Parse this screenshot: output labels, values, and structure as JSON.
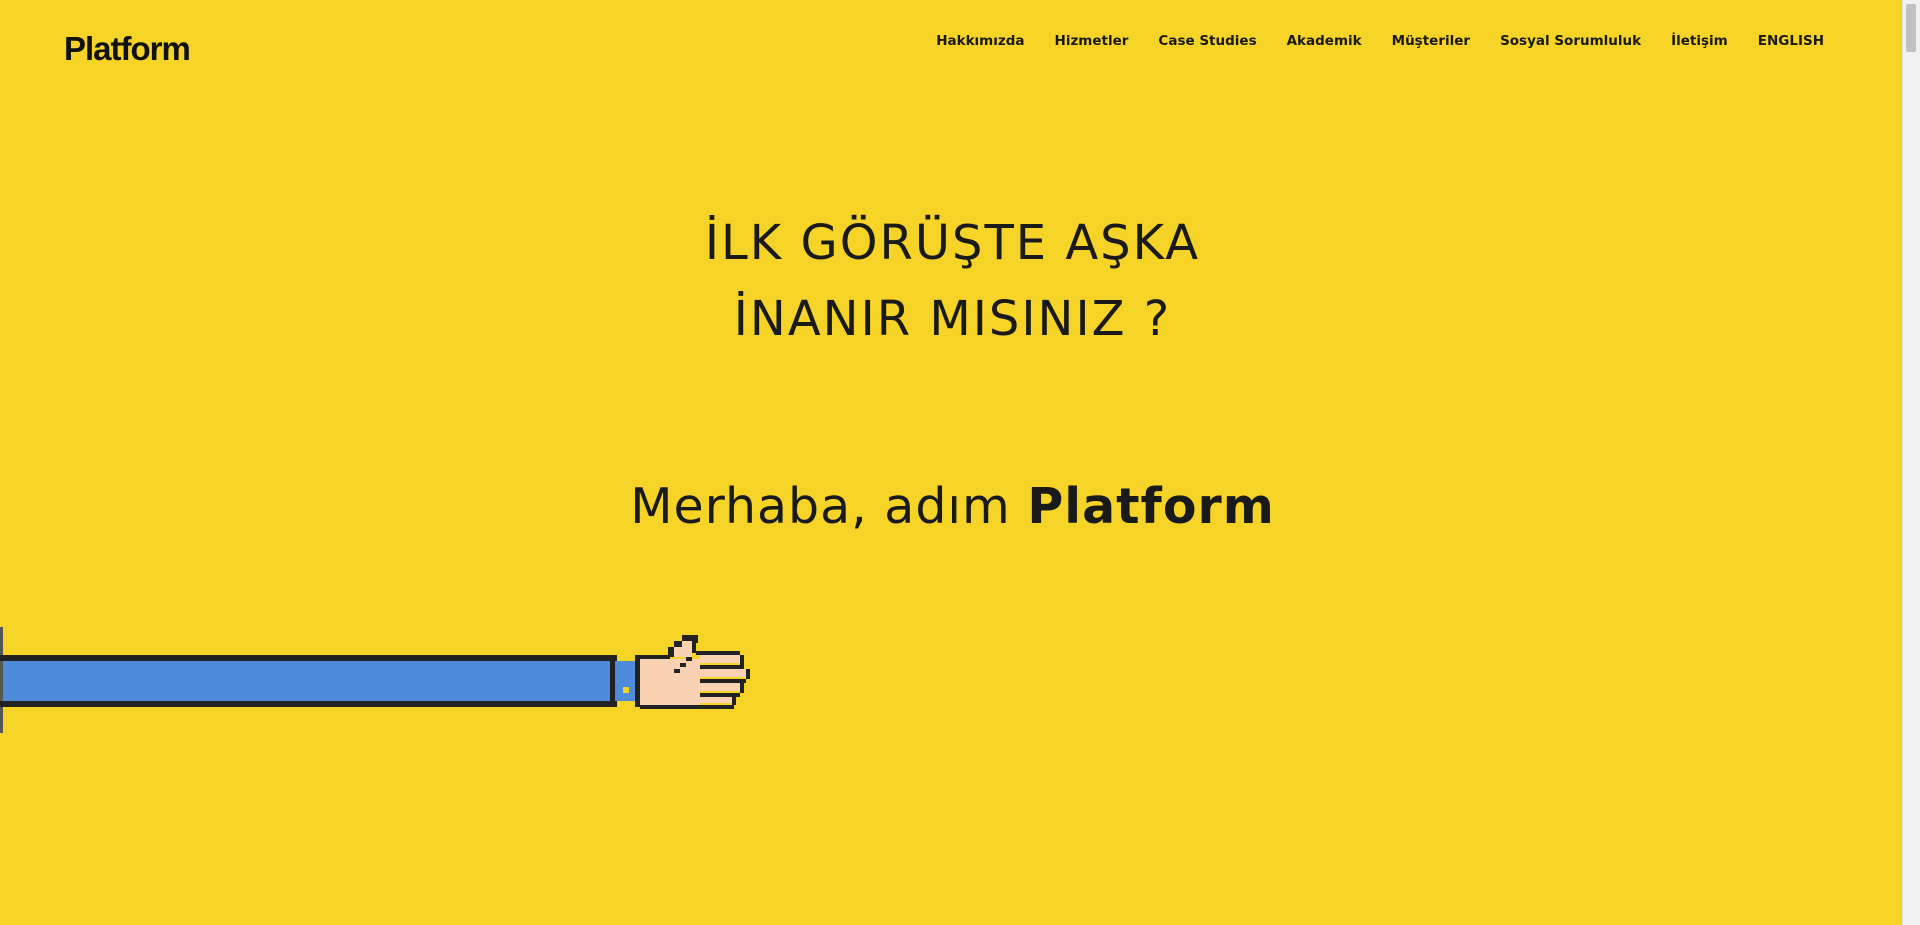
{
  "header": {
    "logo": "Platform",
    "nav": [
      {
        "label": "Hakkımızda"
      },
      {
        "label": "Hizmetler"
      },
      {
        "label": "Case Studies"
      },
      {
        "label": "Akademik"
      },
      {
        "label": "Müşteriler"
      },
      {
        "label": "Sosyal Sorumluluk"
      },
      {
        "label": "İletişim"
      },
      {
        "label": "ENGLISH"
      }
    ]
  },
  "hero": {
    "line1": "İLK GÖRÜŞTE AŞKA",
    "line2": "İNANIR MISINIZ ?",
    "greeting_prefix": "Merhaba, adım ",
    "greeting_name": "Platform"
  },
  "colors": {
    "background": "#F5D327",
    "sleeve": "#4F8BDB",
    "skin": "#F9D2B4",
    "outline": "#222222"
  },
  "illustration": {
    "arm_icon": "pixel-hand-arm-icon"
  }
}
